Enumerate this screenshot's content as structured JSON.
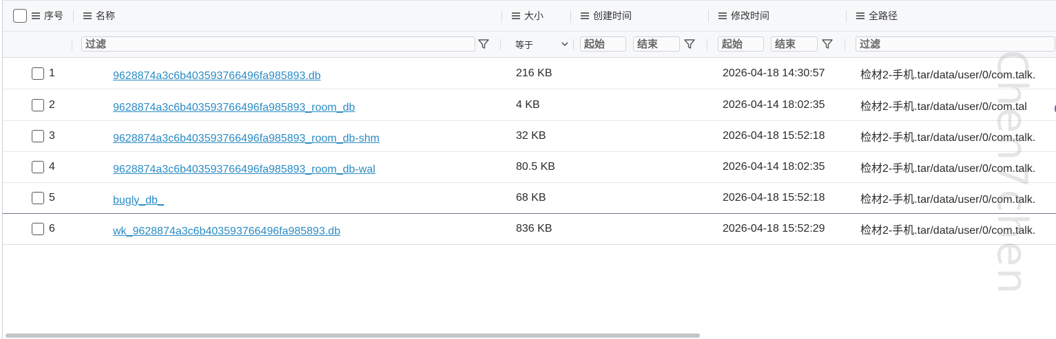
{
  "header": {
    "index_label": "序号",
    "name_label": "名称",
    "size_label": "大小",
    "ctime_label": "创建时间",
    "mtime_label": "修改时间",
    "path_label": "全路径"
  },
  "filters": {
    "name_placeholder": "过滤",
    "size_operator": "等于",
    "ctime_start_placeholder": "起始",
    "ctime_end_placeholder": "结束",
    "mtime_start_placeholder": "起始",
    "mtime_end_placeholder": "结束",
    "path_placeholder": "过滤"
  },
  "rows": [
    {
      "index": "1",
      "name": "9628874a3c6b403593766496fa985893.db",
      "size": "216 KB",
      "ctime": "",
      "mtime": "2026-04-18 14:30:57",
      "path": "检材2-手机.tar/data/user/0/com.talk."
    },
    {
      "index": "2",
      "name": "9628874a3c6b403593766496fa985893_room_db",
      "size": "4 KB",
      "ctime": "",
      "mtime": "2026-04-14 18:02:35",
      "path": "检材2-手机.tar/data/user/0/com.tal"
    },
    {
      "index": "3",
      "name": "9628874a3c6b403593766496fa985893_room_db-shm",
      "size": "32 KB",
      "ctime": "",
      "mtime": "2026-04-18 15:52:18",
      "path": "检材2-手机.tar/data/user/0/com.talk."
    },
    {
      "index": "4",
      "name": "9628874a3c6b403593766496fa985893_room_db-wal",
      "size": "80.5 KB",
      "ctime": "",
      "mtime": "2026-04-14 18:02:35",
      "path": "检材2-手机.tar/data/user/0/com.talk."
    },
    {
      "index": "5",
      "name": "bugly_db_",
      "size": "68 KB",
      "ctime": "",
      "mtime": "2026-04-18 15:52:18",
      "path": "检材2-手机.tar/data/user/0/com.talk."
    },
    {
      "index": "6",
      "name": "wk_9628874a3c6b403593766496fa985893.db",
      "size": "836 KB",
      "ctime": "",
      "mtime": "2026-04-18 15:52:29",
      "path": "检材2-手机.tar/data/user/0/com.talk."
    }
  ],
  "watermark": "Chen7chen",
  "colors": {
    "link": "#2a8bc4",
    "header_bg": "#f7f8fa",
    "accent_purple": "#6b5fcf"
  }
}
